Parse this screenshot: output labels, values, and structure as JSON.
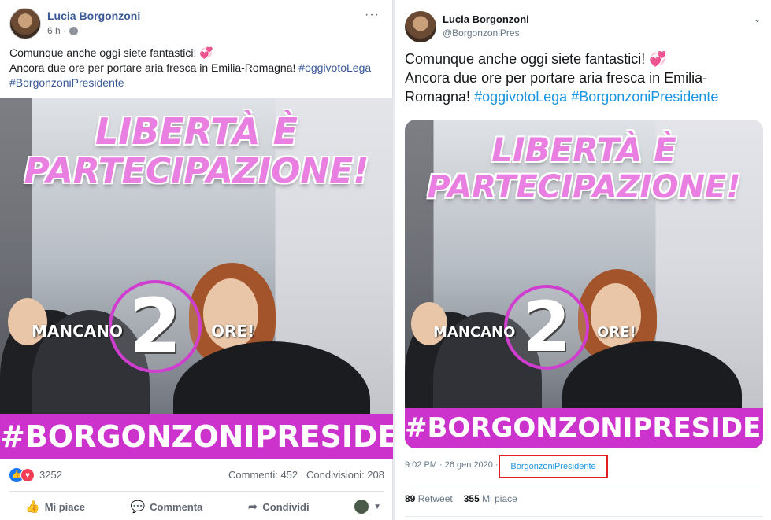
{
  "facebook": {
    "author": "Lucia Borgonzoni",
    "time": "6 h ·",
    "more_icon": "more-dots-icon",
    "text_line1": "Comunque anche oggi siete fantastici!",
    "text_line2": "Ancora due ore per portare aria fresca in Emilia-Romagna!",
    "hashtag1": "#oggivotoLega",
    "hashtag2": "#BorgonzoniPresidente",
    "reactions_count": "3252",
    "comments": "Commenti: 452",
    "shares": "Condivisioni: 208",
    "actions": {
      "like": "Mi piace",
      "comment": "Commenta",
      "share": "Condividi"
    }
  },
  "image": {
    "title_line1": "LIBERTÀ È",
    "title_line2": "PARTECIPAZIONE!",
    "left_word": "MANCANO",
    "number": "2",
    "right_word": "ORE!",
    "banner": "#BORGONZONIPRESIDENTE"
  },
  "twitter": {
    "author": "Lucia Borgonzoni",
    "handle": "@BorgonzoniPres",
    "text_line1": "Comunque anche oggi siete fantastici!",
    "text_line2": "Ancora due ore per portare aria fresca in Emilia-Romagna!",
    "hashtag1": "#oggivotoLega",
    "hashtag2": "#BorgonzoniPresidente",
    "timestamp": "9:02 PM · 26 gen 2020 ·",
    "source_link": "BorgonzoniPresidente",
    "retweets_num": "89",
    "retweets_label": "Retweet",
    "likes_num": "355",
    "likes_label": "Mi piace"
  },
  "colors": {
    "fb_link": "#385898",
    "tw_link": "#1b95e0",
    "banner": "#cc33cc",
    "highlight_box": "#e02020"
  }
}
